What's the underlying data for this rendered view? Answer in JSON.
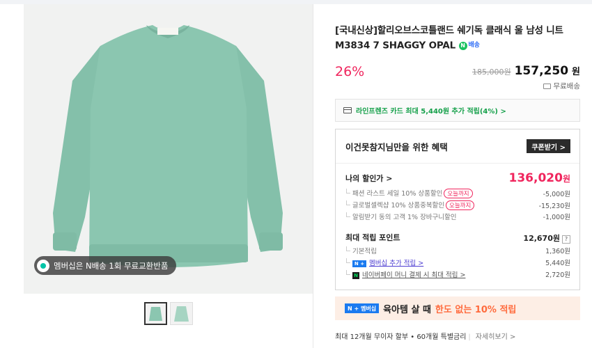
{
  "product": {
    "title": "[국내신상]할리오브스코틀랜드 쉐기독 클래식 울 남성 니트 M3834 7 SHAGGY OPAL",
    "badge": "배송",
    "discount": "26%",
    "original_price": "185,000원",
    "sale_price": "157,250",
    "sale_unit": "원",
    "shipping": "무료배송",
    "colors": {
      "accent": "#f0255d",
      "sweater": "#86c2ad"
    }
  },
  "gallery": {
    "membership_pill": "멤버십은 N배송 1회 무료교환반품",
    "thumbnails": [
      "thumb-1",
      "thumb-2"
    ]
  },
  "card_banner": "라인프렌즈 카드 최대 5,440원 추가 적립(4%) >",
  "benefit": {
    "title": "이건못참지님만을 위한 혜택",
    "coupon_button": "쿠폰받기 >",
    "my_price_label": "나의 할인가 >",
    "my_price": "136,020",
    "my_price_unit": "원",
    "discount_items": [
      {
        "label": "패션 라스트 세일 10% 상품할인",
        "tag": "오늘까지",
        "value": "-5,000원"
      },
      {
        "label": "글로벌셀렉샵 10% 상품중복할인",
        "tag": "오늘까지",
        "value": "-15,230원"
      },
      {
        "label": "알림받기 동의 고객 1% 장바구니할인",
        "tag": "",
        "value": "-1,000원"
      }
    ],
    "points_label": "최대 적립 포인트",
    "points_total": "12,670원",
    "points_help": "?",
    "point_items": [
      {
        "label": "기본적립",
        "value": "1,360원"
      },
      {
        "label": "멤버십 추가 적립 >",
        "value": "5,440원"
      },
      {
        "label": "네이버페이 머니 결제 시 최대 적립 >",
        "value": "2,720원"
      }
    ],
    "nplus_badge": "N +",
    "npay_badge": "N"
  },
  "promo": {
    "badge": "N + 멤버십",
    "text_prefix": "육아템 살 때",
    "text_accent": "한도 없는 10% 적립"
  },
  "installment": {
    "text": "최대 12개월 무이자 할부 • 60개월 특별금리",
    "more": "자세히보기 >"
  }
}
